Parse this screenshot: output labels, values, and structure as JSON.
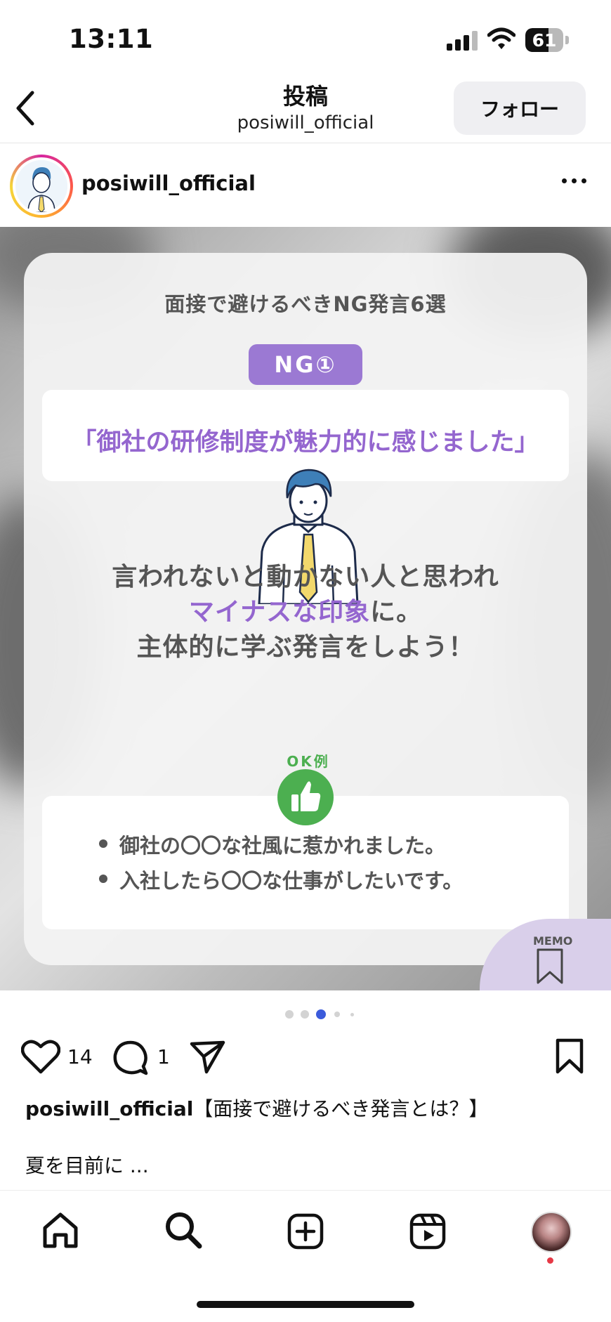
{
  "status_bar": {
    "time": "13:11",
    "battery": "61",
    "battery_level": 0.61
  },
  "header": {
    "title": "投稿",
    "subtitle": "posiwill_official",
    "follow_label": "フォロー"
  },
  "account": {
    "username": "posiwill_official"
  },
  "post": {
    "card_title": "面接で避けるべきNG発言6選",
    "badge": "NG①",
    "quote": "「御社の研修制度が魅力的に感じました」",
    "message_line1": "言われないと動かない人と思われ",
    "message_line2_highlight": "マイナスな印象",
    "message_line2_rest": "に。",
    "message_line3": "主体的に学ぶ発言をしよう！",
    "ok_label": "OK例",
    "ok_items": [
      "御社の〇〇な社風に惹かれました。",
      "入社したら〇〇な仕事がしたいです。"
    ],
    "memo_label": "MEMO",
    "colors": {
      "accent_purple": "#9b79d3",
      "ok_green": "#4caf50"
    }
  },
  "carousel": {
    "active_index": 2,
    "count": 5
  },
  "actions": {
    "likes": "14",
    "comments": "1"
  },
  "caption": {
    "username": "posiwill_official",
    "text": "【面接で避けるべき発言とは？】",
    "preview": "夏を目前に ..."
  },
  "nav": {
    "items": [
      "home-icon",
      "search-icon",
      "create-icon",
      "reels-icon",
      "profile-avatar"
    ]
  }
}
